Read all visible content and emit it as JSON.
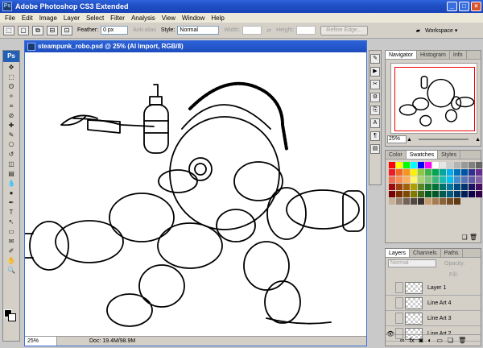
{
  "app": {
    "title": "Adobe Photoshop CS3 Extended",
    "logo_text": "Ps"
  },
  "window_controls": {
    "minimize": "_",
    "maximize": "□",
    "close": "×"
  },
  "menu": [
    "File",
    "Edit",
    "Image",
    "Layer",
    "Select",
    "Filter",
    "Analysis",
    "View",
    "Window",
    "Help"
  ],
  "options": {
    "feather_label": "Feather:",
    "feather_value": "0 px",
    "anti_alias_label": "Anti-alias",
    "style_label": "Style:",
    "style_value": "Normal",
    "width_label": "Width:",
    "height_label": "Height:",
    "refine_edge": "Refine Edge...",
    "workspace": "Workspace ▾"
  },
  "toolbox": {
    "tools": [
      "move-tool",
      "marquee-tool",
      "lasso-tool",
      "magic-wand-tool",
      "crop-tool",
      "slice-tool",
      "healing-tool",
      "brush-tool",
      "clone-stamp-tool",
      "history-brush-tool",
      "eraser-tool",
      "gradient-tool",
      "blur-tool",
      "dodge-tool",
      "pen-tool",
      "type-tool",
      "path-select-tool",
      "shape-tool",
      "notes-tool",
      "eyedropper-tool",
      "hand-tool",
      "zoom-tool"
    ],
    "glyphs": [
      "✥",
      "⬚",
      "ʘ",
      "✧",
      "⌗",
      "⊘",
      "✚",
      "✎",
      "⎔",
      "↺",
      "◫",
      "▤",
      "💧",
      "●",
      "✒",
      "T",
      "↖",
      "▭",
      "✉",
      "✐",
      "✋",
      "🔍"
    ],
    "foreground_color": "#000000",
    "background_color": "#ffffff"
  },
  "document": {
    "title": "steampunk_robo.psd @ 25% (AI Import, RGB/8)",
    "zoom": "25%",
    "doc_info": "Doc: 19.4M/98.9M"
  },
  "navigator": {
    "tabs": [
      "Navigator",
      "Histogram",
      "Info"
    ],
    "zoom": "25%"
  },
  "color_panel": {
    "tabs": [
      "Color",
      "Swatches",
      "Styles"
    ],
    "swatches": [
      "#ff0000",
      "#ffff00",
      "#00ff00",
      "#00ffff",
      "#0000ff",
      "#ff00ff",
      "#ffffff",
      "#e6e6e6",
      "#cccccc",
      "#b3b3b3",
      "#999999",
      "#808080",
      "#666666",
      "#4d4d4d",
      "#333333",
      "#ee1d24",
      "#f26522",
      "#f7941d",
      "#fff200",
      "#8dc63f",
      "#39b54a",
      "#00a651",
      "#00a99d",
      "#00aeef",
      "#0072bc",
      "#0054a6",
      "#2e3192",
      "#662d91",
      "#92278f",
      "#ec008c",
      "#f26c4f",
      "#f68e55",
      "#fbaf5c",
      "#fff568",
      "#acd373",
      "#7cc576",
      "#3bb878",
      "#1abbb4",
      "#00bff3",
      "#438ccb",
      "#5574b9",
      "#605ca8",
      "#855fa8",
      "#a763a8",
      "#f06ea9",
      "#9e0b0f",
      "#a0410d",
      "#a36209",
      "#aba000",
      "#598527",
      "#1a7b30",
      "#007236",
      "#00746b",
      "#0076a3",
      "#004b80",
      "#003471",
      "#1b1464",
      "#440e62",
      "#630460",
      "#9e005d",
      "#790000",
      "#7b2e00",
      "#7d4900",
      "#827b00",
      "#406618",
      "#005e20",
      "#005826",
      "#005952",
      "#005b7f",
      "#003663",
      "#002157",
      "#0d004c",
      "#32004b",
      "#4b0049",
      "#7b0046",
      "#c7b299",
      "#998675",
      "#736357",
      "#534741",
      "#37302d",
      "#c69c6d",
      "#a67c52",
      "#8c6239",
      "#754c24",
      "#603913"
    ]
  },
  "layers": {
    "tabs": [
      "Layers",
      "Channels",
      "Paths"
    ],
    "blend_mode": "Normal",
    "opacity_label": "Opacity:",
    "fill_label": "Fill:",
    "rows": [
      {
        "name": "Layer 1",
        "visible": false
      },
      {
        "name": "Line Art 4",
        "visible": false
      },
      {
        "name": "Line Art 3",
        "visible": false
      },
      {
        "name": "Line Art 2",
        "visible": true
      }
    ],
    "footer_icons": [
      "link-icon",
      "fx-icon",
      "mask-icon",
      "adjustment-icon",
      "group-icon",
      "new-layer-icon",
      "trash-icon"
    ],
    "footer_glyphs": [
      "∞",
      "fx",
      "◙",
      "◐",
      "▭",
      "❏",
      "🗑"
    ]
  },
  "dock": {
    "icons": [
      "brush-panel-icon",
      "tool-presets-icon",
      "clone-source-icon",
      "actions-icon",
      "history-icon",
      "character-icon",
      "paragraph-icon",
      "layer-comps-icon"
    ],
    "glyphs": [
      "✎",
      "▶",
      "✂",
      "⚙",
      "⎘",
      "A",
      "¶",
      "▤"
    ]
  }
}
